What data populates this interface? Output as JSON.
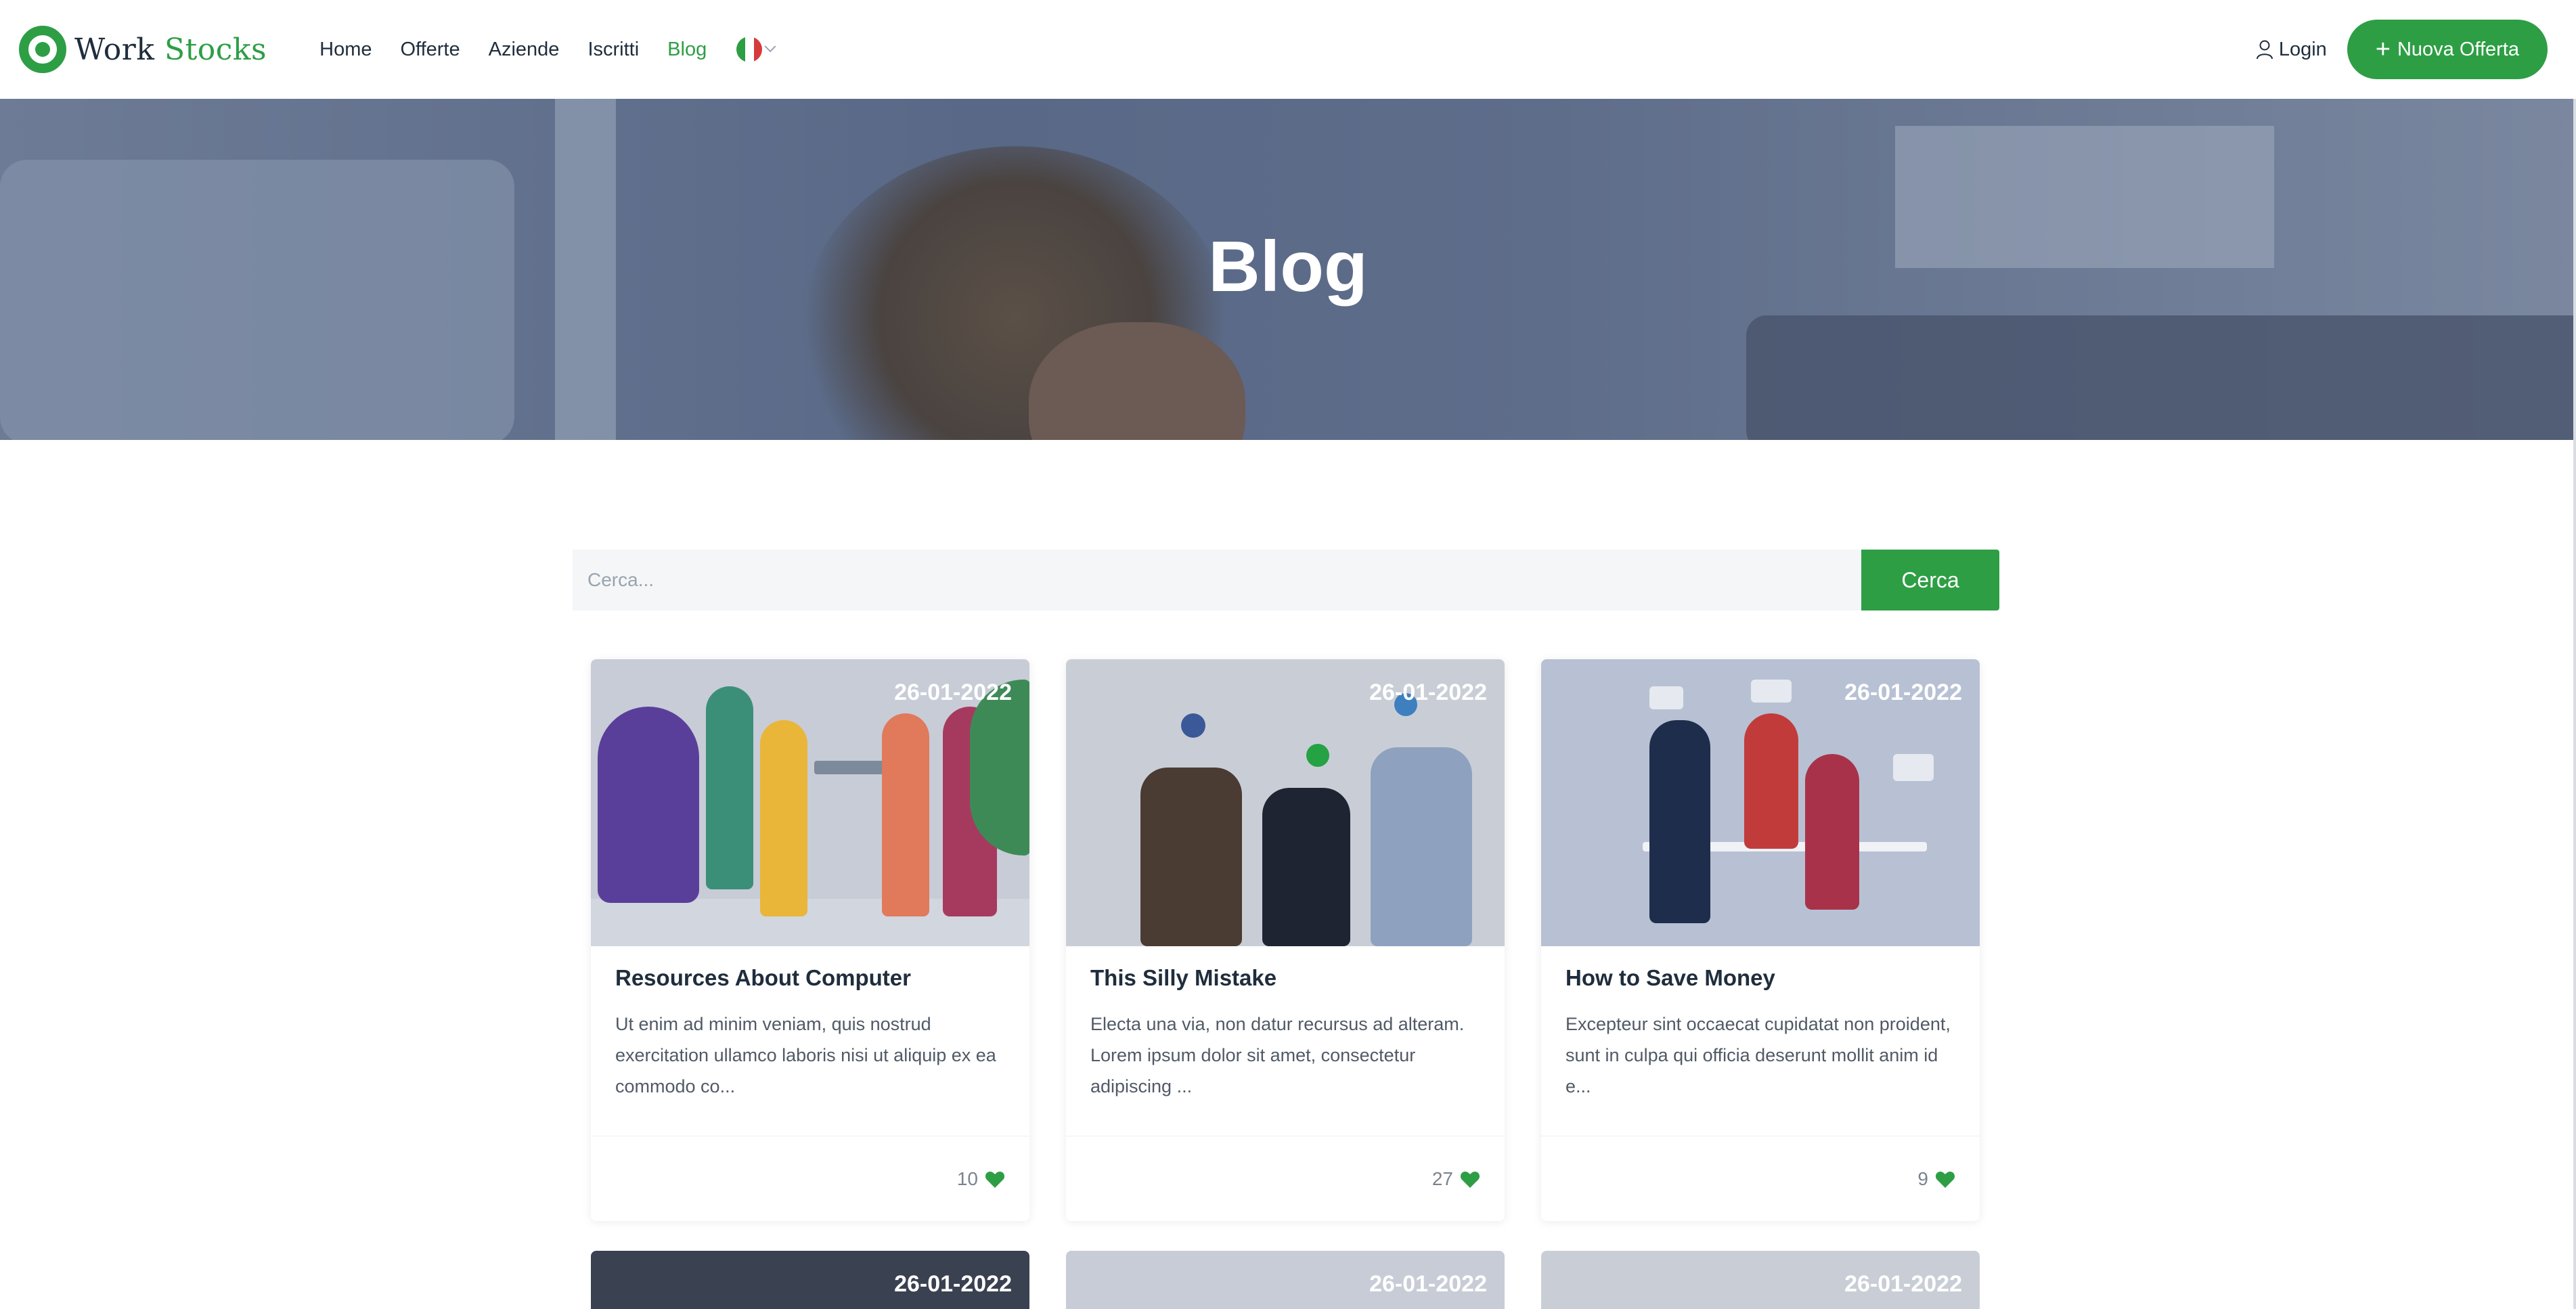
{
  "brand": {
    "name_part1": "Work",
    "name_part2": "Stocks"
  },
  "nav": [
    {
      "label": "Home",
      "active": false
    },
    {
      "label": "Offerte",
      "active": false
    },
    {
      "label": "Aziende",
      "active": false
    },
    {
      "label": "Iscritti",
      "active": false
    },
    {
      "label": "Blog",
      "active": true
    }
  ],
  "language": {
    "flag": "italy-flag-icon"
  },
  "header": {
    "login_label": "Login",
    "new_offer_label": "Nuova Offerta"
  },
  "hero": {
    "title": "Blog"
  },
  "search": {
    "placeholder": "Cerca...",
    "value": "",
    "button_label": "Cerca"
  },
  "posts": [
    {
      "date": "26-01-2022",
      "title": "Resources About Computer",
      "excerpt": "Ut enim ad minim veniam, quis nostrud exercitation ullamco laboris nisi ut aliquip ex ea commodo co...",
      "likes": "10"
    },
    {
      "date": "26-01-2022",
      "title": "This Silly Mistake",
      "excerpt": "Electa una via, non datur recursus ad alteram. Lorem ipsum dolor sit amet, consectetur adipiscing ...",
      "likes": "27"
    },
    {
      "date": "26-01-2022",
      "title": "How to Save Money",
      "excerpt": "Excepteur sint occaecat cupidatat non proident, sunt in culpa qui officia deserunt mollit anim id e...",
      "likes": "9"
    }
  ],
  "partial_posts": [
    {
      "date": "26-01-2022"
    },
    {
      "date": "26-01-2022"
    },
    {
      "date": "26-01-2022"
    }
  ],
  "colors": {
    "accent": "#2e9e45",
    "text": "#1f2d3d",
    "muted": "#505a66",
    "hero_overlay": "#586886"
  }
}
